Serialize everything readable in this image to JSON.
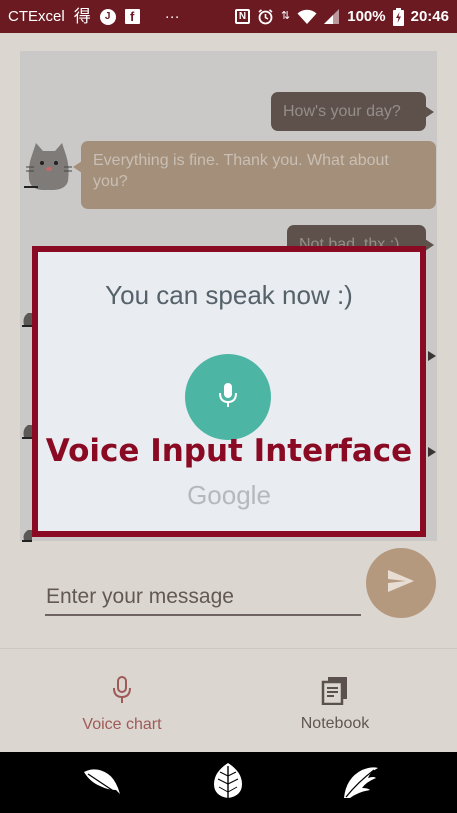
{
  "status_bar": {
    "carrier": "CTExcel",
    "char": "得",
    "ellipsis": "···",
    "battery": "100%",
    "time": "20:46"
  },
  "chat": {
    "messages": [
      {
        "side": "out",
        "text": "How's your day?"
      },
      {
        "side": "in",
        "text": "Everything is fine. Thank you. What about you?"
      },
      {
        "side": "out",
        "text": "Not bad, thx ;)"
      }
    ]
  },
  "composer": {
    "placeholder": "Enter your message"
  },
  "bottom_nav": {
    "voice_label": "Voice chart",
    "notebook_label": "Notebook"
  },
  "dialog": {
    "prompt": "You can speak now :)",
    "caption": "Voice Input Interface",
    "brand": "Google"
  },
  "colors": {
    "status_bar": "#6b1a22",
    "dialog_border": "#8a0a24",
    "mic_button": "#4cb5a4",
    "send_button": "#b4997f"
  },
  "icons": {
    "send": "send-arrow-icon",
    "mic": "microphone-icon",
    "notebook": "notebook-icon",
    "sys_back": "feather-icon",
    "sys_home": "leaf-icon",
    "sys_recent": "wing-icon"
  }
}
